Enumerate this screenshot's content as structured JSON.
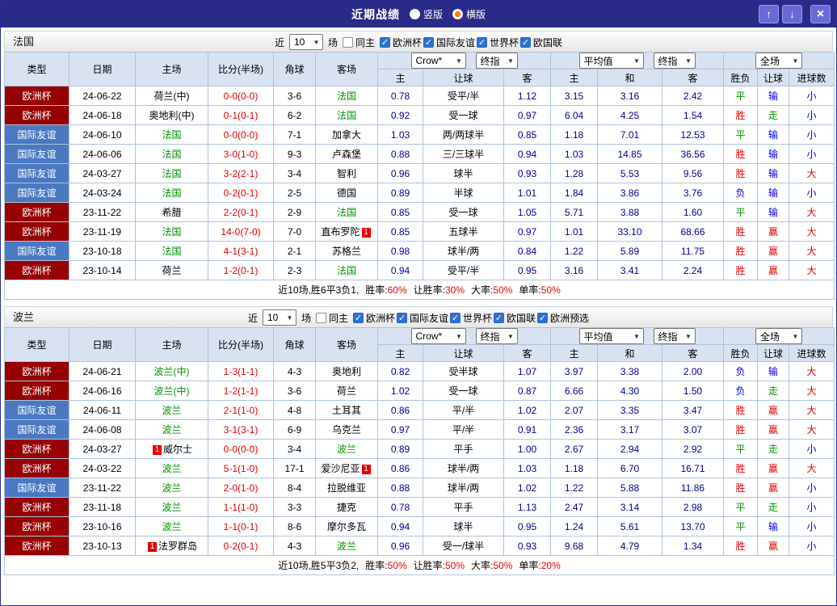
{
  "titlebar": {
    "title": "近期战绩",
    "radio_options": [
      {
        "label": "竖版",
        "selected": false
      },
      {
        "label": "横版",
        "selected": true
      }
    ],
    "buttons": {
      "up": "↑",
      "down": "↓",
      "close": "×"
    }
  },
  "filter_bar": {
    "near_label": "近",
    "match_count": "10",
    "matches_label": "场",
    "same_home_label": "同主"
  },
  "table": {
    "columns": {
      "type": "类型",
      "date": "日期",
      "home": "主场",
      "score": "比分(半场)",
      "corners": "角球",
      "away": "客场",
      "odds_home": "主",
      "odds_handicap": "让球",
      "odds_away": "客",
      "avg_home": "主",
      "avg_draw": "和",
      "avg_away": "客",
      "result": "胜负",
      "handicap_result": "让球",
      "goals_result": "进球数"
    },
    "dropdowns": {
      "bookmaker": "Crow*",
      "final_odds": "终指",
      "average": "平均值",
      "final_odds2": "终指",
      "scope": "全场"
    }
  },
  "colors": {
    "titlebar_bg": "#2a2a87",
    "euro_type_bg": "#970101",
    "friendly_type_bg": "#4a79c2",
    "focus_team_green": "#009300",
    "score_red": "#e60000",
    "odds_navy": "#000096",
    "win_red": "#e60000",
    "draw_green": "#009300",
    "lose_blue": "#0000e6",
    "header_bg": "#d9e2f1"
  },
  "sections": [
    {
      "team": "法国",
      "competitions": [
        "欧洲杯",
        "国际友谊",
        "世界杯",
        "欧国联"
      ],
      "rows": [
        {
          "type": "欧洲杯",
          "date": "24-06-22",
          "home": "荷兰(中)",
          "home_focus": false,
          "score": "0-0(0-0)",
          "corners": "3-6",
          "away": "法国",
          "away_focus": true,
          "odds": [
            "0.78",
            "受平/半",
            "1.12"
          ],
          "avg": [
            "3.15",
            "3.16",
            "2.42"
          ],
          "verdicts": [
            "平",
            "输",
            "小"
          ]
        },
        {
          "type": "欧洲杯",
          "date": "24-06-18",
          "home": "奥地利(中)",
          "home_focus": false,
          "score": "0-1(0-1)",
          "corners": "6-2",
          "away": "法国",
          "away_focus": true,
          "odds": [
            "0.92",
            "受一球",
            "0.97"
          ],
          "avg": [
            "6.04",
            "4.25",
            "1.54"
          ],
          "verdicts": [
            "胜",
            "走",
            "小"
          ]
        },
        {
          "type": "国际友谊",
          "date": "24-06-10",
          "home": "法国",
          "home_focus": true,
          "score": "0-0(0-0)",
          "corners": "7-1",
          "away": "加拿大",
          "away_focus": false,
          "odds": [
            "1.03",
            "两/两球半",
            "0.85"
          ],
          "avg": [
            "1.18",
            "7.01",
            "12.53"
          ],
          "verdicts": [
            "平",
            "输",
            "小"
          ]
        },
        {
          "type": "国际友谊",
          "date": "24-06-06",
          "home": "法国",
          "home_focus": true,
          "score": "3-0(1-0)",
          "corners": "9-3",
          "away": "卢森堡",
          "away_focus": false,
          "odds": [
            "0.88",
            "三/三球半",
            "0.94"
          ],
          "avg": [
            "1.03",
            "14.85",
            "36.56"
          ],
          "verdicts": [
            "胜",
            "输",
            "小"
          ]
        },
        {
          "type": "国际友谊",
          "date": "24-03-27",
          "home": "法国",
          "home_focus": true,
          "score": "3-2(2-1)",
          "corners": "3-4",
          "away": "智利",
          "away_focus": false,
          "odds": [
            "0.96",
            "球半",
            "0.93"
          ],
          "avg": [
            "1.28",
            "5.53",
            "9.56"
          ],
          "verdicts": [
            "胜",
            "输",
            "大"
          ]
        },
        {
          "type": "国际友谊",
          "date": "24-03-24",
          "home": "法国",
          "home_focus": true,
          "score": "0-2(0-1)",
          "corners": "2-5",
          "away": "德国",
          "away_focus": false,
          "odds": [
            "0.89",
            "半球",
            "1.01"
          ],
          "avg": [
            "1.84",
            "3.86",
            "3.76"
          ],
          "verdicts": [
            "负",
            "输",
            "小"
          ]
        },
        {
          "type": "欧洲杯",
          "date": "23-11-22",
          "home": "希腊",
          "home_focus": false,
          "score": "2-2(0-1)",
          "corners": "2-9",
          "away": "法国",
          "away_focus": true,
          "odds": [
            "0.85",
            "受一球",
            "1.05"
          ],
          "avg": [
            "5.71",
            "3.88",
            "1.60"
          ],
          "verdicts": [
            "平",
            "输",
            "大"
          ]
        },
        {
          "type": "欧洲杯",
          "date": "23-11-19",
          "home": "法国",
          "home_focus": true,
          "score": "14-0(7-0)",
          "corners": "7-0",
          "away": "直布罗陀",
          "away_focus": false,
          "away_badge": "1",
          "odds": [
            "0.85",
            "五球半",
            "0.97"
          ],
          "avg": [
            "1.01",
            "33.10",
            "68.66"
          ],
          "verdicts": [
            "胜",
            "赢",
            "大"
          ]
        },
        {
          "type": "国际友谊",
          "date": "23-10-18",
          "home": "法国",
          "home_focus": true,
          "score": "4-1(3-1)",
          "corners": "2-1",
          "away": "苏格兰",
          "away_focus": false,
          "odds": [
            "0.98",
            "球半/两",
            "0.84"
          ],
          "avg": [
            "1.22",
            "5.89",
            "11.75"
          ],
          "verdicts": [
            "胜",
            "赢",
            "大"
          ]
        },
        {
          "type": "欧洲杯",
          "date": "23-10-14",
          "home": "荷兰",
          "home_focus": false,
          "score": "1-2(0-1)",
          "corners": "2-3",
          "away": "法国",
          "away_focus": true,
          "odds": [
            "0.94",
            "受平/半",
            "0.95"
          ],
          "avg": [
            "3.16",
            "3.41",
            "2.24"
          ],
          "verdicts": [
            "胜",
            "赢",
            "大"
          ]
        }
      ],
      "summary": {
        "record": "近10场,胜6平3负1,",
        "stats": [
          {
            "label": "胜率:",
            "value": "60%"
          },
          {
            "label": "让胜率:",
            "value": "30%"
          },
          {
            "label": "大率:",
            "value": "50%"
          },
          {
            "label": "单率:",
            "value": "50%"
          }
        ]
      }
    },
    {
      "team": "波兰",
      "competitions": [
        "欧洲杯",
        "国际友谊",
        "世界杯",
        "欧国联",
        "欧洲预选"
      ],
      "rows": [
        {
          "type": "欧洲杯",
          "date": "24-06-21",
          "home": "波兰(中)",
          "home_focus": true,
          "score": "1-3(1-1)",
          "corners": "4-3",
          "away": "奥地利",
          "away_focus": false,
          "odds": [
            "0.82",
            "受半球",
            "1.07"
          ],
          "avg": [
            "3.97",
            "3.38",
            "2.00"
          ],
          "verdicts": [
            "负",
            "输",
            "大"
          ]
        },
        {
          "type": "欧洲杯",
          "date": "24-06-16",
          "home": "波兰(中)",
          "home_focus": true,
          "score": "1-2(1-1)",
          "corners": "3-6",
          "away": "荷兰",
          "away_focus": false,
          "odds": [
            "1.02",
            "受一球",
            "0.87"
          ],
          "avg": [
            "6.66",
            "4.30",
            "1.50"
          ],
          "verdicts": [
            "负",
            "走",
            "大"
          ]
        },
        {
          "type": "国际友谊",
          "date": "24-06-11",
          "home": "波兰",
          "home_focus": true,
          "score": "2-1(1-0)",
          "corners": "4-8",
          "away": "土耳其",
          "away_focus": false,
          "odds": [
            "0.86",
            "平/半",
            "1.02"
          ],
          "avg": [
            "2.07",
            "3.35",
            "3.47"
          ],
          "verdicts": [
            "胜",
            "赢",
            "大"
          ]
        },
        {
          "type": "国际友谊",
          "date": "24-06-08",
          "home": "波兰",
          "home_focus": true,
          "score": "3-1(3-1)",
          "corners": "6-9",
          "away": "乌克兰",
          "away_focus": false,
          "odds": [
            "0.97",
            "平/半",
            "0.91"
          ],
          "avg": [
            "2.36",
            "3.17",
            "3.07"
          ],
          "verdicts": [
            "胜",
            "赢",
            "大"
          ]
        },
        {
          "type": "欧洲杯",
          "date": "24-03-27",
          "home": "威尔士",
          "home_focus": false,
          "home_badge": "1",
          "score": "0-0(0-0)",
          "corners": "3-4",
          "away": "波兰",
          "away_focus": true,
          "odds": [
            "0.89",
            "平手",
            "1.00"
          ],
          "avg": [
            "2.67",
            "2.94",
            "2.92"
          ],
          "verdicts": [
            "平",
            "走",
            "小"
          ]
        },
        {
          "type": "欧洲杯",
          "date": "24-03-22",
          "home": "波兰",
          "home_focus": true,
          "score": "5-1(1-0)",
          "corners": "17-1",
          "away": "爱沙尼亚",
          "away_focus": false,
          "away_badge": "1",
          "odds": [
            "0.86",
            "球半/两",
            "1.03"
          ],
          "avg": [
            "1.18",
            "6.70",
            "16.71"
          ],
          "verdicts": [
            "胜",
            "赢",
            "大"
          ]
        },
        {
          "type": "国际友谊",
          "date": "23-11-22",
          "home": "波兰",
          "home_focus": true,
          "score": "2-0(1-0)",
          "corners": "8-4",
          "away": "拉脱维亚",
          "away_focus": false,
          "odds": [
            "0.88",
            "球半/两",
            "1.02"
          ],
          "avg": [
            "1.22",
            "5.88",
            "11.86"
          ],
          "verdicts": [
            "胜",
            "赢",
            "小"
          ]
        },
        {
          "type": "欧洲杯",
          "date": "23-11-18",
          "home": "波兰",
          "home_focus": true,
          "score": "1-1(1-0)",
          "corners": "3-3",
          "away": "捷克",
          "away_focus": false,
          "odds": [
            "0.78",
            "平手",
            "1.13"
          ],
          "avg": [
            "2.47",
            "3.14",
            "2.98"
          ],
          "verdicts": [
            "平",
            "走",
            "小"
          ]
        },
        {
          "type": "欧洲杯",
          "date": "23-10-16",
          "home": "波兰",
          "home_focus": true,
          "score": "1-1(0-1)",
          "corners": "8-6",
          "away": "摩尔多瓦",
          "away_focus": false,
          "odds": [
            "0.94",
            "球半",
            "0.95"
          ],
          "avg": [
            "1.24",
            "5.61",
            "13.70"
          ],
          "verdicts": [
            "平",
            "输",
            "小"
          ]
        },
        {
          "type": "欧洲杯",
          "date": "23-10-13",
          "home": "法罗群岛",
          "home_focus": false,
          "home_badge": "1",
          "score": "0-2(0-1)",
          "corners": "4-3",
          "away": "波兰",
          "away_focus": true,
          "odds": [
            "0.96",
            "受一/球半",
            "0.93"
          ],
          "avg": [
            "9.68",
            "4.79",
            "1.34"
          ],
          "verdicts": [
            "胜",
            "赢",
            "小"
          ]
        }
      ],
      "summary": {
        "record": "近10场,胜5平3负2,",
        "stats": [
          {
            "label": "胜率:",
            "value": "50%"
          },
          {
            "label": "让胜率:",
            "value": "50%"
          },
          {
            "label": "大率:",
            "value": "50%"
          },
          {
            "label": "单率:",
            "value": "20%"
          }
        ]
      }
    }
  ]
}
